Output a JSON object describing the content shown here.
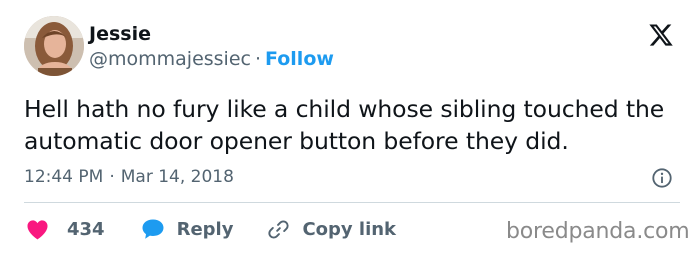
{
  "user": {
    "name": "Jessie",
    "handle": "@mommajessiec",
    "separator": "·",
    "follow_label": "Follow"
  },
  "tweet": {
    "text": "Hell hath no fury like a child whose sibling touched the automatic door opener button before they did.",
    "time": "12:44 PM",
    "separator": "·",
    "date": "Mar 14, 2018"
  },
  "actions": {
    "like_count": "434",
    "reply_label": "Reply",
    "copy_link_label": "Copy link"
  },
  "watermark": "boredpanda.com",
  "icons": {
    "logo": "x-logo-icon",
    "info": "info-icon",
    "like": "heart-icon",
    "reply": "speech-bubble-icon",
    "copy": "link-icon"
  },
  "colors": {
    "follow": "#1d9bf0",
    "like": "#f91880",
    "reply": "#1d9bf0",
    "text": "#0f1419",
    "muted": "#536471"
  }
}
